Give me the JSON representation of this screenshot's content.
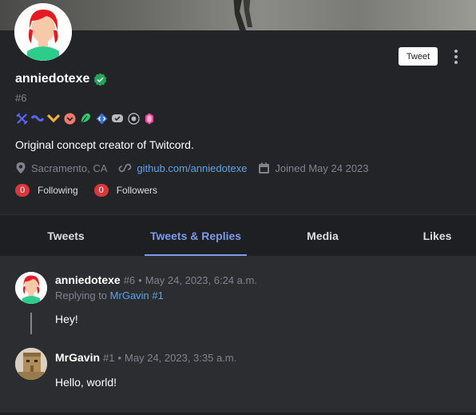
{
  "profile": {
    "username": "anniedotexe",
    "discriminator": "#6",
    "bio": "Original concept creator of Twitcord.",
    "location": "Sacramento, CA",
    "website": "github.com/anniedotexe",
    "joined": "Joined May 24 2023",
    "following_count": "0",
    "following_label": "Following",
    "followers_count": "0",
    "followers_label": "Followers",
    "tweet_button": "Tweet",
    "badges": [
      "hypesquad-icon",
      "nitro-icon",
      "boost-icon",
      "bug-hunter-icon",
      "early-supporter-icon",
      "active-developer-icon",
      "verified-developer-icon",
      "moderator-icon",
      "hypesquad-events-icon"
    ]
  },
  "tabs": [
    {
      "label": "Tweets",
      "active": false
    },
    {
      "label": "Tweets & Replies",
      "active": true
    },
    {
      "label": "Media",
      "active": false
    },
    {
      "label": "Likes",
      "active": false
    }
  ],
  "posts": [
    {
      "author": "anniedotexe",
      "discriminator": "#6",
      "separator": "•",
      "timestamp": "May 24, 2023, 6:24 a.m.",
      "replying_prefix": "Replying to",
      "replying_to": "MrGavin #1",
      "body": "Hey!"
    },
    {
      "author": "MrGavin",
      "discriminator": "#1",
      "separator": "•",
      "timestamp": "May 24, 2023, 3:35 a.m.",
      "body": "Hello, world!"
    }
  ],
  "colors": {
    "accent": "#7d9be8",
    "link": "#5ea3e8",
    "badge_red": "#da373c",
    "verified_green": "#23a55a"
  }
}
